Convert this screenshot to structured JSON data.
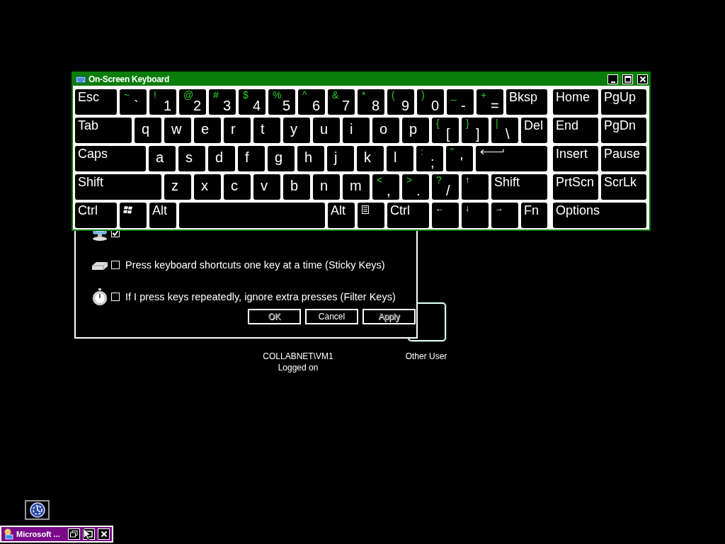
{
  "keyboard_window": {
    "title": "On-Screen Keyboard",
    "rows": [
      {
        "main": [
          {
            "kind": "label",
            "label": "Esc"
          },
          {
            "kind": "dual",
            "shift": "~",
            "label": "`"
          },
          {
            "kind": "dual",
            "shift": "!",
            "label": "1"
          },
          {
            "kind": "dual",
            "shift": "@",
            "label": "2"
          },
          {
            "kind": "dual",
            "shift": "#",
            "label": "3"
          },
          {
            "kind": "dual",
            "shift": "$",
            "label": "4"
          },
          {
            "kind": "dual",
            "shift": "%",
            "label": "5"
          },
          {
            "kind": "dual",
            "shift": "^",
            "label": "6"
          },
          {
            "kind": "dual",
            "shift": "&",
            "label": "7"
          },
          {
            "kind": "dual",
            "shift": "*",
            "label": "8"
          },
          {
            "kind": "dual",
            "shift": "(",
            "label": "9"
          },
          {
            "kind": "dual",
            "shift": ")",
            "label": "0"
          },
          {
            "kind": "dual",
            "shift": "_",
            "label": "-"
          },
          {
            "kind": "dual",
            "shift": "+",
            "label": "="
          },
          {
            "kind": "label",
            "label": "Bksp"
          }
        ],
        "side": [
          {
            "kind": "label",
            "label": "Home"
          },
          {
            "kind": "label",
            "label": "PgUp"
          }
        ]
      },
      {
        "main": [
          {
            "kind": "label",
            "label": "Tab"
          },
          {
            "kind": "char",
            "label": "q"
          },
          {
            "kind": "char",
            "label": "w"
          },
          {
            "kind": "char",
            "label": "e"
          },
          {
            "kind": "char",
            "label": "r"
          },
          {
            "kind": "char",
            "label": "t"
          },
          {
            "kind": "char",
            "label": "y"
          },
          {
            "kind": "char",
            "label": "u"
          },
          {
            "kind": "char",
            "label": "i"
          },
          {
            "kind": "char",
            "label": "o"
          },
          {
            "kind": "char",
            "label": "p"
          },
          {
            "kind": "dual",
            "shift": "{",
            "label": "["
          },
          {
            "kind": "dual",
            "shift": "}",
            "label": "]"
          },
          {
            "kind": "dual",
            "shift": "|",
            "label": "\\"
          },
          {
            "kind": "label",
            "label": "Del"
          }
        ],
        "side": [
          {
            "kind": "label",
            "label": "End"
          },
          {
            "kind": "label",
            "label": "PgDn"
          }
        ]
      },
      {
        "main": [
          {
            "kind": "label",
            "label": "Caps"
          },
          {
            "kind": "char",
            "label": "a"
          },
          {
            "kind": "char",
            "label": "s"
          },
          {
            "kind": "char",
            "label": "d"
          },
          {
            "kind": "char",
            "label": "f"
          },
          {
            "kind": "char",
            "label": "g"
          },
          {
            "kind": "char",
            "label": "h"
          },
          {
            "kind": "char",
            "label": "j"
          },
          {
            "kind": "char",
            "label": "k"
          },
          {
            "kind": "char",
            "label": "l"
          },
          {
            "kind": "dual",
            "shift": ":",
            "label": ";"
          },
          {
            "kind": "dual",
            "shift": "\"",
            "label": "'"
          },
          {
            "kind": "enter"
          }
        ],
        "side": [
          {
            "kind": "label",
            "label": "Insert"
          },
          {
            "kind": "label",
            "label": "Pause"
          }
        ]
      },
      {
        "main": [
          {
            "kind": "label",
            "label": "Shift"
          },
          {
            "kind": "char",
            "label": "z"
          },
          {
            "kind": "char",
            "label": "x"
          },
          {
            "kind": "char",
            "label": "c"
          },
          {
            "kind": "char",
            "label": "v"
          },
          {
            "kind": "char",
            "label": "b"
          },
          {
            "kind": "char",
            "label": "n"
          },
          {
            "kind": "char",
            "label": "m"
          },
          {
            "kind": "dual",
            "shift": "<",
            "label": ","
          },
          {
            "kind": "dual",
            "shift": ">",
            "label": "."
          },
          {
            "kind": "dual",
            "shift": "?",
            "label": "/"
          },
          {
            "kind": "arrow",
            "label": "↑"
          },
          {
            "kind": "label",
            "label": "Shift"
          }
        ],
        "side": [
          {
            "kind": "label",
            "label": "PrtScn"
          },
          {
            "kind": "label",
            "label": "ScrLk"
          }
        ]
      },
      {
        "main": [
          {
            "kind": "label",
            "label": "Ctrl"
          },
          {
            "kind": "windows"
          },
          {
            "kind": "label",
            "label": "Alt"
          },
          {
            "kind": "space"
          },
          {
            "kind": "label",
            "label": "Alt"
          },
          {
            "kind": "menu"
          },
          {
            "kind": "label",
            "label": "Ctrl"
          },
          {
            "kind": "arrow",
            "label": "←"
          },
          {
            "kind": "arrow",
            "label": "↓"
          },
          {
            "kind": "arrow",
            "label": "→"
          },
          {
            "kind": "label",
            "label": "Fn"
          }
        ],
        "side": [
          {
            "kind": "label",
            "label": "Options"
          }
        ]
      }
    ]
  },
  "ease_dialog": {
    "options": [
      {
        "checked": true
      },
      {
        "label": "Press keyboard shortcuts one key at a time (Sticky Keys)",
        "checked": false
      },
      {
        "label": "If I press keys repeatedly, ignore extra presses (Filter Keys)",
        "checked": false
      }
    ],
    "buttons": [
      {
        "label": "OK",
        "disabled": true
      },
      {
        "label": "Cancel",
        "disabled": false
      },
      {
        "label": "Apply",
        "disabled": true
      }
    ]
  },
  "user_tiles": [
    {
      "name": "COLLABNET\\VM1",
      "status": "Logged on"
    },
    {
      "name": "Other User"
    }
  ],
  "minimized_window": {
    "title": "Microsoft ..."
  }
}
